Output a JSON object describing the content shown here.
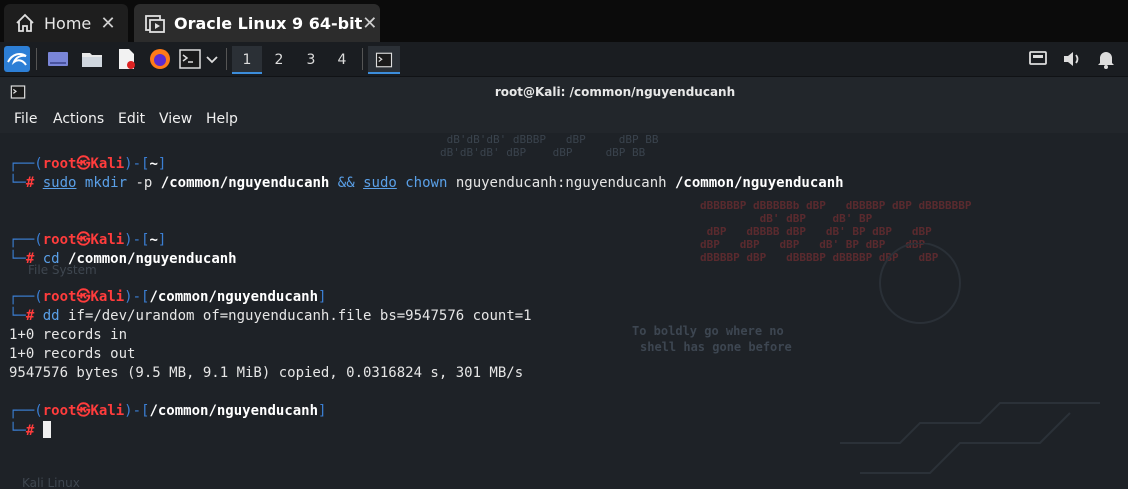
{
  "host_tabs": {
    "home_label": "Home",
    "vm_label": "Oracle Linux 9 64-bit",
    "close_glyph": "✕"
  },
  "panel": {
    "workspaces": [
      "1",
      "2",
      "3",
      "4"
    ],
    "active_workspace": "1"
  },
  "window": {
    "title": "root@Kali: /common/nguyenducanh"
  },
  "menu": [
    "File",
    "Actions",
    "Edit",
    "View",
    "Help"
  ],
  "prompt": {
    "user": "root",
    "skull": "㉿",
    "host": "Kali",
    "hash": "#"
  },
  "terminal": {
    "block1": {
      "path": "~",
      "sudo1": "sudo",
      "cmd1": "mkdir",
      "arg1": "-p",
      "path1": "/common/nguyenducanh",
      "and": "&&",
      "sudo2": "sudo",
      "cmd2": "chown",
      "owner": "nguyenducanh:nguyenducanh",
      "path2": "/common/nguyenducanh"
    },
    "block2": {
      "path": "~",
      "cmd": "cd",
      "arg": "/common/nguyenducanh"
    },
    "block3": {
      "path": "/common/nguyenducanh",
      "cmd": "dd",
      "args": "if=/dev/urandom of=nguyenducanh.file bs=9547576 count=1",
      "out1": "1+0 records in",
      "out2": "1+0 records out",
      "out3": "9547576 bytes (9.5 MB, 9.1 MiB) copied, 0.0316824 s, 301 MB/s"
    },
    "block4": {
      "path": "/common/nguyenducanh"
    }
  },
  "wallpaper": {
    "slogan1": "To boldly go where no",
    "slogan2": "shell has gone before",
    "desktop_icon1": "File System",
    "desktop_icon2": "Kali Linux"
  }
}
